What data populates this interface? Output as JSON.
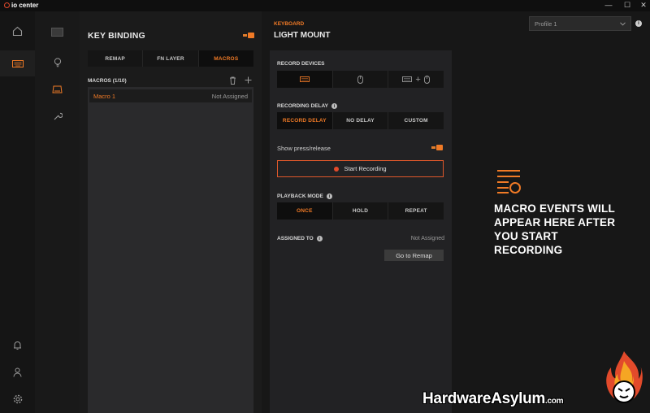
{
  "app": {
    "name": "io center"
  },
  "window_controls": {
    "minimize": "—",
    "maximize": "☐",
    "close": "✕"
  },
  "rail": {
    "items": [
      {
        "icon": "home-icon",
        "active": false
      },
      {
        "icon": "keyboard-icon",
        "active": true
      }
    ],
    "bottom": [
      {
        "icon": "bell-icon"
      },
      {
        "icon": "user-icon"
      },
      {
        "icon": "gear-icon"
      }
    ]
  },
  "subrail": {
    "items": [
      {
        "icon": "device-thumbnail"
      },
      {
        "icon": "lightbulb-icon"
      },
      {
        "icon": "keyboard-bind-icon",
        "active": true
      },
      {
        "icon": "wrench-icon"
      }
    ]
  },
  "key_binding": {
    "title": "KEY BINDING",
    "tabs": [
      {
        "label": "REMAP",
        "selected": false
      },
      {
        "label": "FN LAYER",
        "selected": false
      },
      {
        "label": "MACROS",
        "selected": true
      }
    ],
    "macros_header": "MACROS (1/10)",
    "macros": [
      {
        "name": "Macro 1",
        "status": "Not Assigned"
      }
    ]
  },
  "config": {
    "device_type": "KEYBOARD",
    "device_name": "LIGHT MOUNT",
    "record_devices_label": "RECORD DEVICES",
    "record_devices_plus": "+",
    "recording_delay_label": "RECORDING DELAY",
    "recording_delay_options": [
      {
        "label": "RECORD DELAY",
        "selected": true
      },
      {
        "label": "NO DELAY",
        "selected": false
      },
      {
        "label": "CUSTOM",
        "selected": false
      }
    ],
    "show_press_release": "Show press/release",
    "start_recording": "Start Recording",
    "playback_mode_label": "PLAYBACK MODE",
    "playback_options": [
      {
        "label": "ONCE",
        "selected": true
      },
      {
        "label": "HOLD",
        "selected": false
      },
      {
        "label": "REPEAT",
        "selected": false
      }
    ],
    "assigned_to_label": "ASSIGNED TO",
    "assigned_to_value": "Not Assigned",
    "go_to_remap": "Go to Remap"
  },
  "profile": {
    "selected": "Profile 1",
    "info": "i"
  },
  "events_placeholder": "MACRO EVENTS WILL APPEAR HERE AFTER YOU START RECORDING",
  "watermark": {
    "text": "HardwareAsylum",
    "suffix": ".com"
  },
  "colors": {
    "accent": "#f07a26",
    "record": "#e24a2b",
    "background": "#131313"
  }
}
